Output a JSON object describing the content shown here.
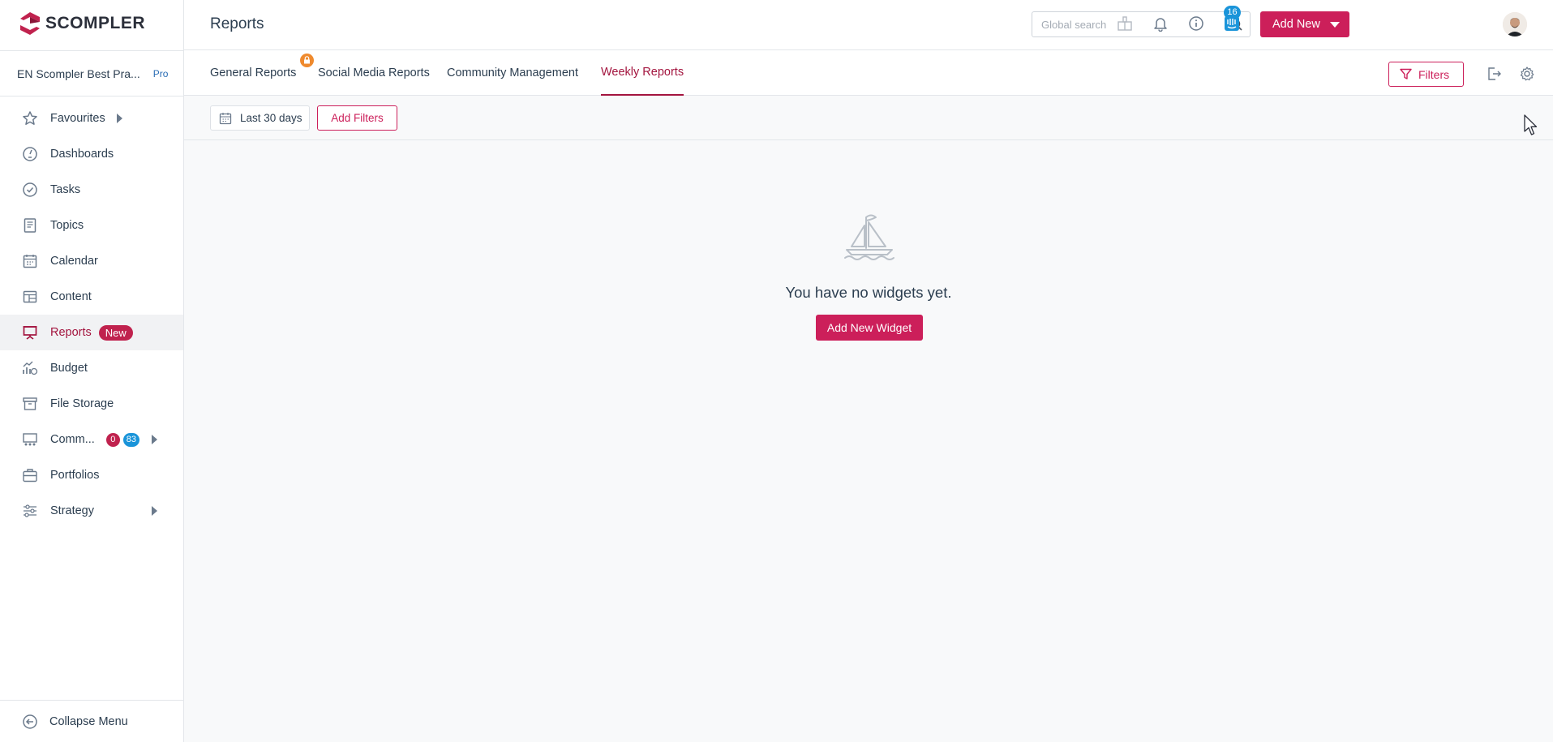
{
  "brand": {
    "name": "SCOMPLER",
    "accent": "#cc1f5a",
    "active_text": "#a3153f"
  },
  "workspace": {
    "name": "EN Scompler Best Pra...",
    "plan": "Pro"
  },
  "sidebar": {
    "items": [
      {
        "label": "Favourites",
        "icon": "star-icon"
      },
      {
        "label": "Dashboards",
        "icon": "gauge-icon"
      },
      {
        "label": "Tasks",
        "icon": "check-circle-icon"
      },
      {
        "label": "Topics",
        "icon": "document-icon"
      },
      {
        "label": "Calendar",
        "icon": "calendar-icon"
      },
      {
        "label": "Content",
        "icon": "table-icon"
      },
      {
        "label": "Reports",
        "icon": "presentation-icon",
        "badge": "New",
        "active": true
      },
      {
        "label": "Budget",
        "icon": "budget-chart-icon"
      },
      {
        "label": "File Storage",
        "icon": "archive-icon"
      },
      {
        "label": "Comm...",
        "icon": "community-icon",
        "count_red": "0",
        "count_blue": "83"
      },
      {
        "label": "Portfolios",
        "icon": "briefcase-icon"
      },
      {
        "label": "Strategy",
        "icon": "sliders-icon"
      }
    ],
    "collapse_label": "Collapse Menu"
  },
  "header": {
    "title": "Reports",
    "search_placeholder": "Global search",
    "add_new_label": "Add New",
    "notifications_count": "16"
  },
  "tabs": [
    {
      "label": "General Reports"
    },
    {
      "label": "Social Media Reports"
    },
    {
      "label": "Community Management"
    },
    {
      "label": "Weekly Reports",
      "active": true
    }
  ],
  "toolbar": {
    "filters_label": "Filters"
  },
  "filter_bar": {
    "date_range": "Last 30 days",
    "add_filters_label": "Add Filters"
  },
  "empty_state": {
    "message": "You have no widgets yet.",
    "button_label": "Add New Widget"
  }
}
